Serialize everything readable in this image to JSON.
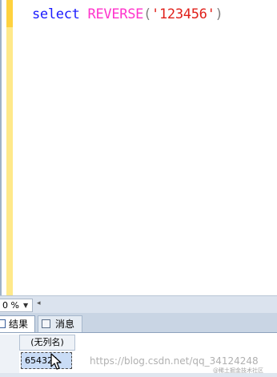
{
  "editor": {
    "code": {
      "keyword": "select",
      "function": "REVERSE",
      "open_paren": "(",
      "quote_open": "'",
      "string_value": "123456",
      "quote_close": "'",
      "close_paren": ")"
    }
  },
  "zoom": {
    "value": "0 %",
    "dropdown_icon": "chevron-down-icon"
  },
  "tabs": [
    {
      "label": "结果",
      "icon": "grid-icon",
      "active": true
    },
    {
      "label": "消息",
      "icon": "message-icon",
      "active": false
    }
  ],
  "results": {
    "columns": [
      "(无列名)"
    ],
    "rows": [
      [
        "654321"
      ]
    ]
  },
  "watermark": {
    "text": "https://blog.csdn.net/qq_34124248",
    "sub": "@稀土掘金技术社区"
  },
  "colors": {
    "keyword": "#1a1aff",
    "function": "#ff33cc",
    "string": "#e0201a",
    "margin_bar": "#ffe98a",
    "selected_cell": "#c9dcf6"
  }
}
